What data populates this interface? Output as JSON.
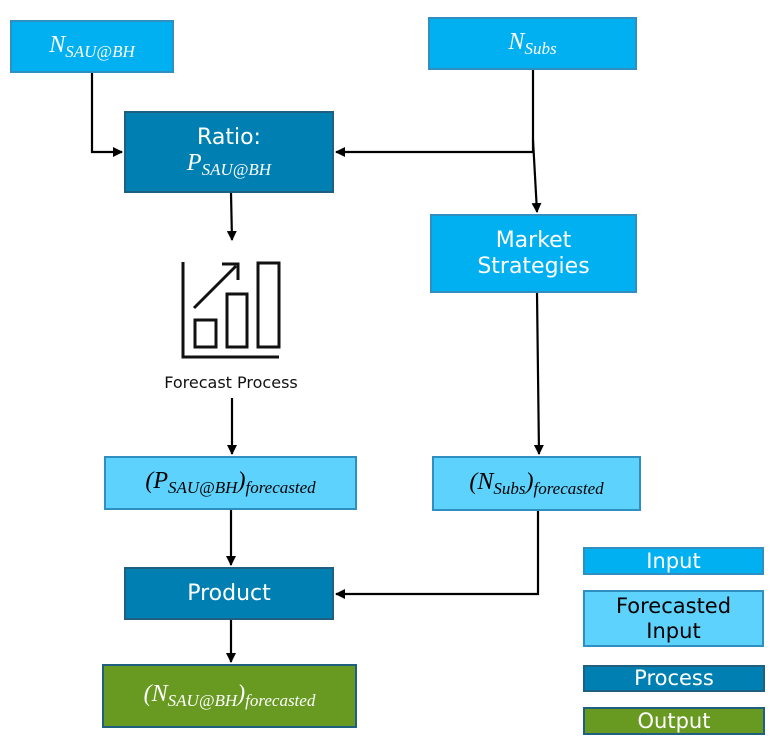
{
  "nodes": {
    "n_sau_bh": {
      "main": "N",
      "sub": "SAU@BH"
    },
    "n_subs": {
      "main": "N",
      "sub": "Subs"
    },
    "ratio": {
      "label": "Ratio:",
      "main": "P",
      "sub": "SAU@BH"
    },
    "market": {
      "line1": "Market",
      "line2": "Strategies"
    },
    "forecast_process": {
      "label": "Forecast Process",
      "icon": "bar-chart-growth-icon"
    },
    "p_forecasted": {
      "open": "(",
      "main": "P",
      "sub": "SAU@BH",
      "close": ")",
      "sub2": "forecasted"
    },
    "n_subs_forecasted": {
      "open": "(",
      "main": "N",
      "sub": "Subs",
      "close": ")",
      "sub2": "forecasted"
    },
    "product": {
      "label": "Product"
    },
    "output": {
      "open": "(",
      "main": "N",
      "sub": "SAU@BH",
      "close": ")",
      "sub2": "forecasted"
    }
  },
  "legend": {
    "input": "Input",
    "forecasted_line1": "Forecasted",
    "forecasted_line2": "Input",
    "process": "Process",
    "output": "Output"
  },
  "colors": {
    "input": "#00B0F0",
    "forecasted_input": "#5DD2FD",
    "process": "#0080B2",
    "output": "#689A22"
  }
}
